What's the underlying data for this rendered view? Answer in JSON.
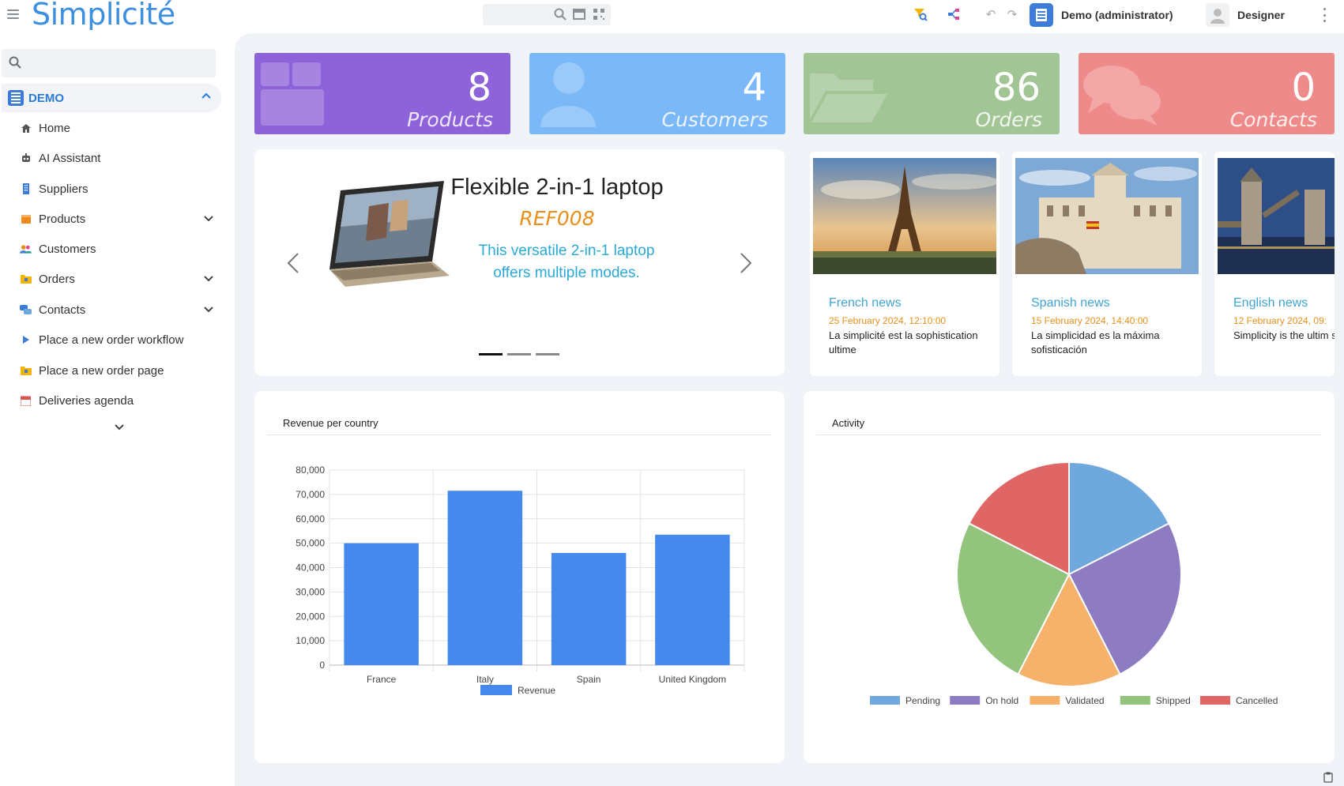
{
  "header": {
    "logo": "Simplicité",
    "user_label": "Demo (administrator)",
    "designer_label": "Designer"
  },
  "sidebar": {
    "search_placeholder": "",
    "group_label": "DEMO",
    "items": [
      {
        "label": "Home",
        "icon": "home-icon",
        "color": "#555555"
      },
      {
        "label": "AI Assistant",
        "icon": "robot-icon",
        "color": "#555555"
      },
      {
        "label": "Suppliers",
        "icon": "building-icon",
        "color": "#3d7dd8"
      },
      {
        "label": "Products",
        "icon": "box-icon",
        "color": "#f0891a"
      },
      {
        "label": "Customers",
        "icon": "users-icon",
        "color": "#e8901b"
      },
      {
        "label": "Orders",
        "icon": "folder-icon",
        "color": "#f4b400"
      },
      {
        "label": "Contacts",
        "icon": "chat-icon",
        "color": "#3d7dd8"
      },
      {
        "label": "Place a new order workflow",
        "icon": "play-icon",
        "color": "#3d7dd8"
      },
      {
        "label": "Place a new order page",
        "icon": "folder-icon",
        "color": "#f4b400"
      },
      {
        "label": "Deliveries agenda",
        "icon": "calendar-icon",
        "color": "#d9534f"
      }
    ]
  },
  "kpis": [
    {
      "count": "8",
      "label": "Products",
      "color": "#8e63d9"
    },
    {
      "count": "4",
      "label": "Customers",
      "color": "#7ab8f8"
    },
    {
      "count": "86",
      "label": "Orders",
      "color": "#a2c596"
    },
    {
      "count": "0",
      "label": "Contacts",
      "color": "#ef8a8a"
    }
  ],
  "carousel": {
    "title": "Flexible 2-in-1 laptop",
    "ref": "REF008",
    "description": "This versatile 2-in-1 laptop offers multiple modes."
  },
  "news": [
    {
      "title": "French news",
      "date": "25 February 2024, 12:10:00",
      "desc": "La simplicité est la sophistication ultime"
    },
    {
      "title": "Spanish news",
      "date": "15 February 2024, 14:40:00",
      "desc": "La simplicidad es la máxima sofisticación"
    },
    {
      "title": "English news",
      "date": "12 February 2024, 09:",
      "desc": "Simplicity is the ultim sophistication"
    }
  ],
  "revenue_panel": {
    "title": "Revenue per country"
  },
  "activity_panel": {
    "title": "Activity"
  },
  "chart_data": [
    {
      "type": "bar",
      "title": "Revenue per country",
      "categories": [
        "France",
        "Italy",
        "Spain",
        "United Kingdom"
      ],
      "series": [
        {
          "name": "Revenue",
          "values": [
            50000,
            71500,
            46000,
            53500
          ],
          "color": "#4589ec"
        }
      ],
      "ylim": [
        0,
        80000
      ],
      "yticks": [
        "0",
        "10,000",
        "20,000",
        "30,000",
        "40,000",
        "50,000",
        "60,000",
        "70,000",
        "80,000"
      ],
      "grid": true,
      "legend": "bottom"
    },
    {
      "type": "pie",
      "title": "Activity",
      "labels": [
        "Pending",
        "On hold",
        "Validated",
        "Shipped",
        "Cancelled"
      ],
      "values": [
        14,
        20,
        12,
        20,
        14
      ],
      "colors": [
        "#6fa8dc",
        "#8e7cc3",
        "#f6b26b",
        "#93c47d",
        "#e06666"
      ],
      "legend": "bottom"
    }
  ]
}
